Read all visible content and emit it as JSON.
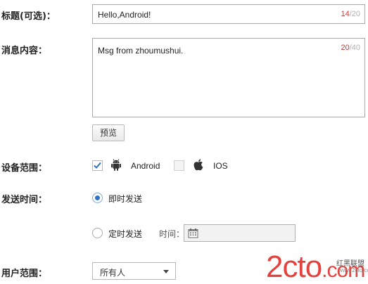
{
  "title_field": {
    "label": "标题(可选)：",
    "value": "Hello,Android!",
    "count": "14",
    "max": "/20"
  },
  "message_field": {
    "label": "消息内容：",
    "value": "Msg from zhoumushui.",
    "count": "20",
    "max": "/40"
  },
  "preview_button": {
    "label": "预览"
  },
  "device_scope": {
    "label": "设备范围：",
    "options": [
      {
        "label": "Android",
        "checked": true,
        "icon": "android-icon"
      },
      {
        "label": "IOS",
        "checked": false,
        "icon": "apple-icon"
      }
    ]
  },
  "send_time": {
    "label": "发送时间：",
    "immediate_label": "即时发送",
    "scheduled_label": "定时发送",
    "time_label": "时间：",
    "selected": "immediate",
    "time_icon": "calendar-icon"
  },
  "user_scope": {
    "label": "用户范围：",
    "selected": "所有人"
  },
  "watermark": {
    "logo_text": "2cto",
    "logo_suffix": ".com",
    "tagline": "红黑联盟",
    "url": "www.2cto.com"
  },
  "colors": {
    "counter_current": "#c23b3b",
    "counter_max": "#b0b0b0",
    "accent": "#2f74c0",
    "watermark": "#e3423f"
  }
}
